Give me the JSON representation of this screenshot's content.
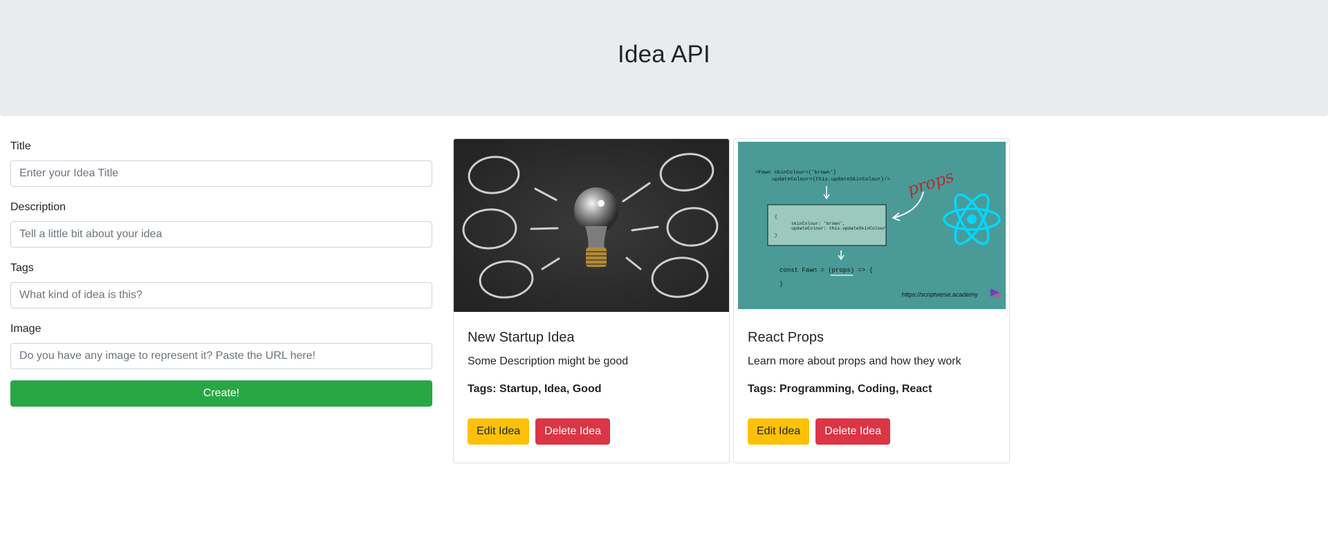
{
  "header": {
    "title": "Idea API"
  },
  "form": {
    "title_label": "Title",
    "title_placeholder": "Enter your Idea Title",
    "description_label": "Description",
    "description_placeholder": "Tell a little bit about your idea",
    "tags_label": "Tags",
    "tags_placeholder": "What kind of idea is this?",
    "image_label": "Image",
    "image_placeholder": "Do you have any image to represent it? Paste the URL here!",
    "create_label": "Create!"
  },
  "ideas": [
    {
      "title": "New Startup Idea",
      "description": "Some Description might be good",
      "tags_prefix": "Tags:",
      "tags": "Startup, Idea, Good",
      "edit_label": "Edit Idea",
      "delete_label": "Delete Idea",
      "image_icon": "lightbulb-chalkboard-image"
    },
    {
      "title": "React Props",
      "description": "Learn more about props and how they work",
      "tags_prefix": "Tags:",
      "tags": "Programming, Coding, React",
      "edit_label": "Edit Idea",
      "delete_label": "Delete Idea",
      "image_icon": "react-props-diagram-image",
      "image_text": {
        "code_line1": "<Fawn skinColour={'brown'}",
        "code_line2": "updateColour={this.updateSkinColour}/>",
        "handwriting": "props",
        "box_open": "{",
        "box_line1": "skinColour: 'brown',",
        "box_line2": "updateColour: this.updateSkinColour",
        "box_close": "}",
        "const_line": "const Fawn = (props) => {",
        "close_brace": "}",
        "url": "https://scriptverse.academy"
      }
    }
  ],
  "colors": {
    "jumbotron_bg": "#e9ecef",
    "success": "#28a745",
    "warning": "#ffc107",
    "danger": "#dc3545",
    "react_teal": "#4a9a98",
    "react_logo": "#00d8ff"
  }
}
